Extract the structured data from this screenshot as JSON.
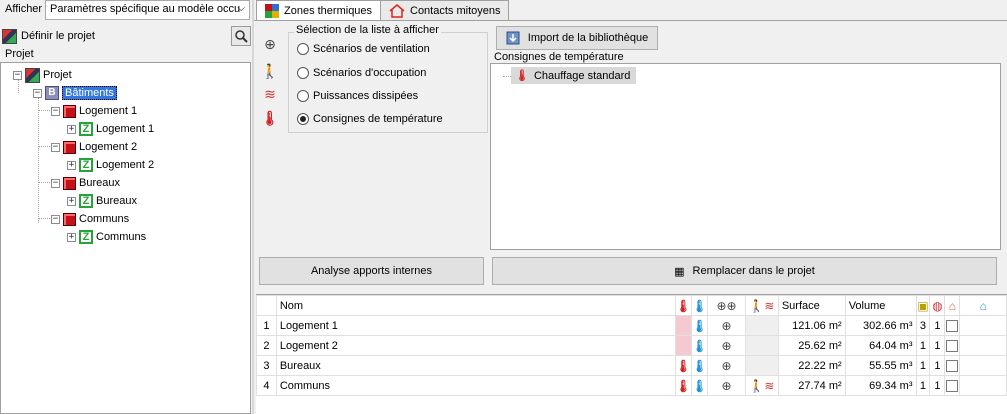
{
  "left": {
    "afficher_label": "Afficher",
    "afficher_value": "Paramètres spécifique au modèle occu",
    "define_project": "Définir le projet",
    "projet_caption": "Projet",
    "tree": {
      "root": "Projet",
      "batiments": "Bâtiments",
      "groups": [
        {
          "label": "Logement 1",
          "zone": "Logement 1"
        },
        {
          "label": "Logement 2",
          "zone": "Logement 2"
        },
        {
          "label": "Bureaux",
          "zone": "Bureaux"
        },
        {
          "label": "Communs",
          "zone": "Communs"
        }
      ]
    }
  },
  "tabs": [
    {
      "label": "Zones thermiques",
      "icon": "zones-icon",
      "active": true
    },
    {
      "label": "Contacts mitoyens",
      "icon": "house-icon",
      "active": false
    }
  ],
  "selection": {
    "title": "Sélection de la liste à afficher",
    "options": [
      {
        "label": "Scénarios de ventilation",
        "checked": false
      },
      {
        "label": "Scénarios d'occupation",
        "checked": false
      },
      {
        "label": "Puissances dissipées",
        "checked": false
      },
      {
        "label": "Consignes de température",
        "checked": true
      }
    ]
  },
  "import_button": "Import de la bibliothèque",
  "consignes": {
    "label": "Consignes de température",
    "items": [
      "Chauffage standard"
    ]
  },
  "analyse_button": "Analyse apports internes",
  "replace_button": "Remplacer dans le projet",
  "table": {
    "headers": {
      "nom": "Nom",
      "surface": "Surface",
      "volume": "Volume"
    },
    "rows": [
      {
        "idx": "1",
        "nom": "Logement 1",
        "surface": "121.06 m²",
        "volume": "302.66 m³",
        "count": "3",
        "n": "1"
      },
      {
        "idx": "2",
        "nom": "Logement 2",
        "surface": "25.62 m²",
        "volume": "64.04 m³",
        "count": "1",
        "n": "1"
      },
      {
        "idx": "3",
        "nom": "Bureaux",
        "surface": "22.22 m²",
        "volume": "55.55 m³",
        "count": "1",
        "n": "1"
      },
      {
        "idx": "4",
        "nom": "Communs",
        "surface": "27.74 m²",
        "volume": "69.34 m³",
        "count": "1",
        "n": "1"
      }
    ]
  },
  "colors": {
    "selection": "#3377dd",
    "pink_cell": "#f4c9d1",
    "zone_green": "#27a33a",
    "building_red": "#c4121a"
  }
}
